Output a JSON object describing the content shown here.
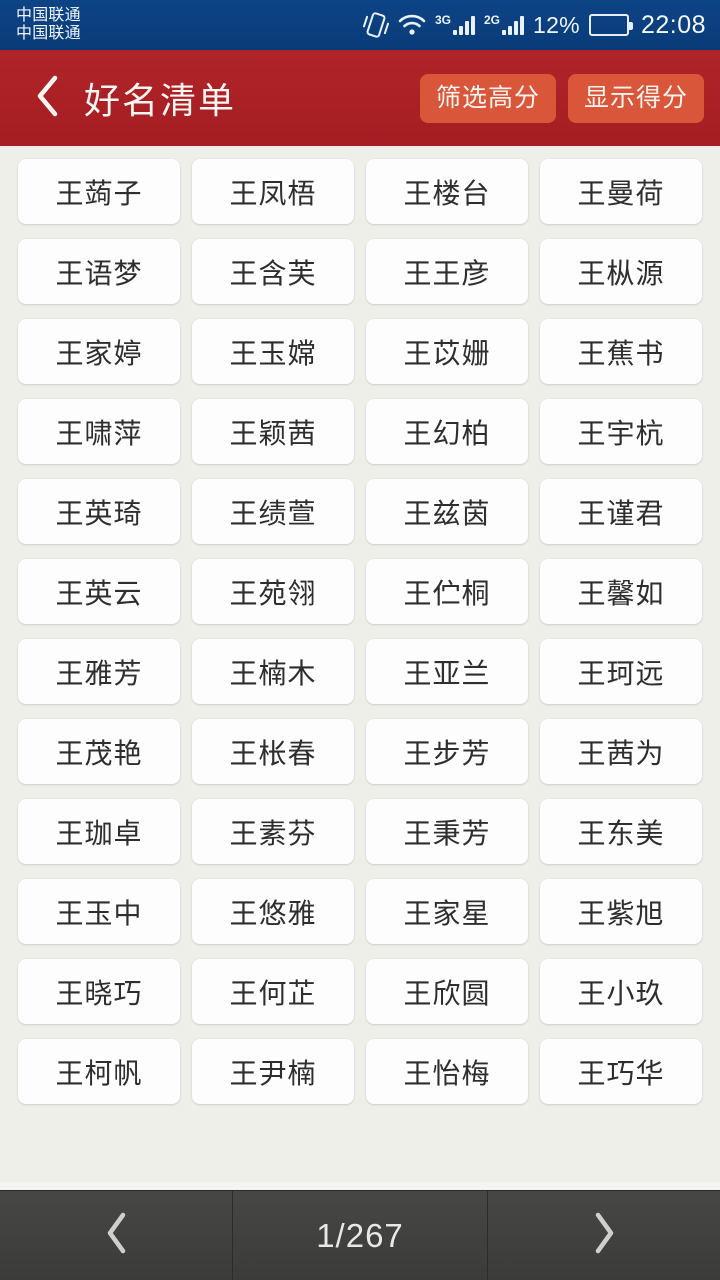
{
  "status_bar": {
    "carrier_line1": "中国联通",
    "carrier_line2": "中国联通",
    "vibrate_icon": "vibrate-icon",
    "wifi_icon": "wifi-icon",
    "sim1_network": "3G",
    "sim2_network": "2G",
    "battery_percent": "12%",
    "clock": "22:08",
    "background_color": "#0c4081"
  },
  "header": {
    "back_icon": "back-chevron-icon",
    "title": "好名清单",
    "filter_high_score_label": "筛选高分",
    "show_score_label": "显示得分",
    "background_color": "#ac2125",
    "button_color": "#d9563a"
  },
  "name_grid": {
    "columns": 4,
    "names": [
      "王蒟子",
      "王凤梧",
      "王楼台",
      "王曼荷",
      "王语梦",
      "王含芙",
      "王王彦",
      "王枞源",
      "王家婷",
      "王玉嫦",
      "王苡姗",
      "王蕉书",
      "王啸萍",
      "王颖茜",
      "王幻柏",
      "王宇杭",
      "王英琦",
      "王绩萱",
      "王兹茵",
      "王谨君",
      "王英云",
      "王苑翎",
      "王伫桐",
      "王馨如",
      "王雅芳",
      "王楠木",
      "王亚兰",
      "王珂远",
      "王茂艳",
      "王枨春",
      "王步芳",
      "王茜为",
      "王珈卓",
      "王素芬",
      "王秉芳",
      "王东美",
      "王玉中",
      "王悠雅",
      "王家星",
      "王紫旭",
      "王晓巧",
      "王何芷",
      "王欣圆",
      "王小玖",
      "王柯帆",
      "王尹楠",
      "王怡梅",
      "王巧华"
    ],
    "card_color": "#fdfdfd",
    "background_color": "#efefea"
  },
  "pagination": {
    "prev_icon": "chevron-left-icon",
    "next_icon": "chevron-right-icon",
    "page_indicator": "1/267",
    "current_page": 1,
    "total_pages": 267,
    "background_color": "#434341"
  }
}
